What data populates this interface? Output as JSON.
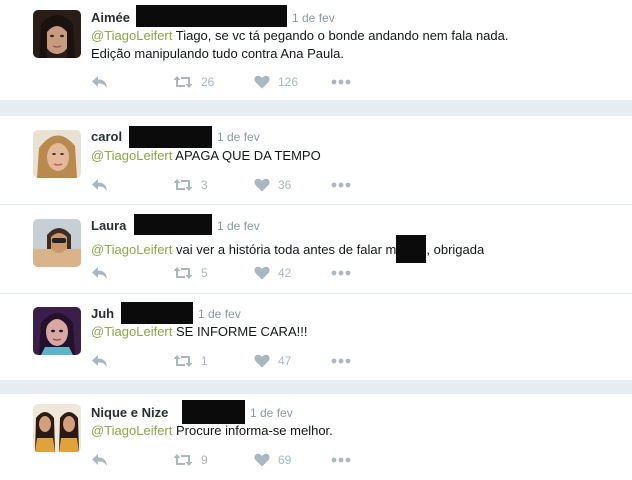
{
  "tweets": [
    {
      "name": "Aimée",
      "time": "1 de fev",
      "mention": "@TiagoLeifert",
      "text": " Tiago, se vc tá pegando o bonde andando nem fala nada.",
      "text2": "Edição manipulando tudo contra Ana Paula.",
      "retweets": "26",
      "likes": "126"
    },
    {
      "name": "carol",
      "time": "1 de fev",
      "mention": "@TiagoLeifert",
      "text": " APAGA QUE DA TEMPO",
      "retweets": "3",
      "likes": "36"
    },
    {
      "name": "Laura",
      "time": "1 de fev",
      "mention": "@TiagoLeifert",
      "text_a": " vai ver a história toda antes de falar m",
      "text_b": ", obrigada",
      "retweets": "5",
      "likes": "42"
    },
    {
      "name": "Juh",
      "time": "1 de fev",
      "mention": "@TiagoLeifert",
      "text": " SE INFORME CARA!!!",
      "retweets": "1",
      "likes": "47"
    },
    {
      "name": "Nique e Nize",
      "time": "1 de fev",
      "mention": "@TiagoLeifert",
      "text": " Procure informa-se melhor.",
      "retweets": "9",
      "likes": "69"
    }
  ],
  "colors": {
    "mention": "#8aa84a",
    "icon": "#aab8c2",
    "separator": "#e6ecf0",
    "redaction": "#0b0b0b"
  },
  "icons": [
    "reply-icon",
    "retweet-icon",
    "heart-icon",
    "more-icon"
  ]
}
